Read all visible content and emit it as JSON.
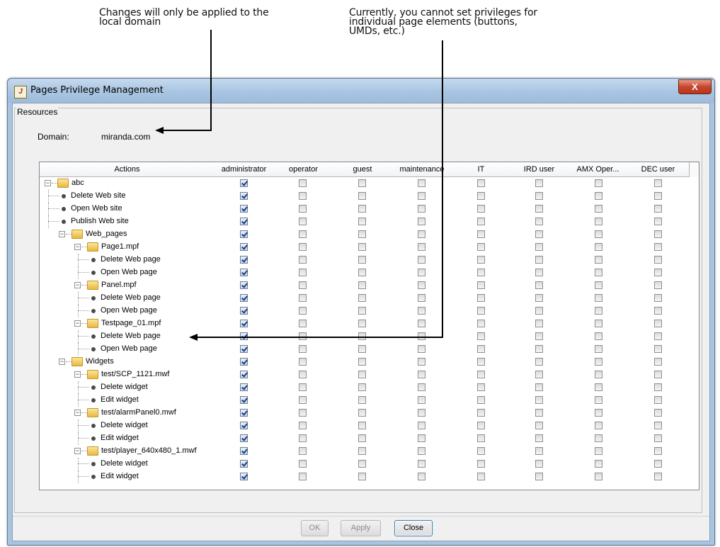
{
  "callouts": {
    "left": [
      "Changes will only be applied to the",
      "local domain"
    ],
    "right": [
      "Currently, you cannot set privileges for",
      "individual page elements (buttons,",
      "UMDs, etc.)"
    ]
  },
  "window": {
    "title": "Pages Privilege Management",
    "close_glyph": "X",
    "app_icon": "jv-app-icon"
  },
  "resources": {
    "group_label": "Resources",
    "domain_label": "Domain:",
    "domain_value": "miranda.com"
  },
  "columns": [
    "Actions",
    "administrator",
    "operator",
    "guest",
    "maintenance",
    "IT",
    "IRD user",
    "AMX Oper...",
    "DEC user"
  ],
  "rows": [
    {
      "label": "abc",
      "type": "folder",
      "level": 0,
      "admin": true
    },
    {
      "label": "Delete Web site",
      "type": "action",
      "level": 1,
      "admin": true
    },
    {
      "label": "Open Web site",
      "type": "action",
      "level": 1,
      "admin": true
    },
    {
      "label": "Publish Web site",
      "type": "action",
      "level": 1,
      "admin": true
    },
    {
      "label": "Web_pages",
      "type": "folder",
      "level": 1,
      "admin": true
    },
    {
      "label": "Page1.mpf",
      "type": "folder",
      "level": 2,
      "admin": true
    },
    {
      "label": "Delete Web page",
      "type": "action",
      "level": 3,
      "admin": true
    },
    {
      "label": "Open Web page",
      "type": "action",
      "level": 3,
      "admin": true
    },
    {
      "label": "Panel.mpf",
      "type": "folder",
      "level": 2,
      "admin": true
    },
    {
      "label": "Delete Web page",
      "type": "action",
      "level": 3,
      "admin": true
    },
    {
      "label": "Open Web page",
      "type": "action",
      "level": 3,
      "admin": true
    },
    {
      "label": "Testpage_01.mpf",
      "type": "folder",
      "level": 2,
      "admin": true
    },
    {
      "label": "Delete Web page",
      "type": "action",
      "level": 3,
      "admin": true
    },
    {
      "label": "Open Web page",
      "type": "action",
      "level": 3,
      "admin": true
    },
    {
      "label": "Widgets",
      "type": "folder",
      "level": 1,
      "admin": true
    },
    {
      "label": "test/SCP_1121.mwf",
      "type": "folder",
      "level": 2,
      "admin": true
    },
    {
      "label": "Delete widget",
      "type": "action",
      "level": 3,
      "admin": true
    },
    {
      "label": "Edit widget",
      "type": "action",
      "level": 3,
      "admin": true
    },
    {
      "label": "test/alarmPanel0.mwf",
      "type": "folder",
      "level": 2,
      "admin": true
    },
    {
      "label": "Delete widget",
      "type": "action",
      "level": 3,
      "admin": true
    },
    {
      "label": "Edit widget",
      "type": "action",
      "level": 3,
      "admin": true
    },
    {
      "label": "test/player_640x480_1.mwf",
      "type": "folder",
      "level": 2,
      "admin": true
    },
    {
      "label": "Delete widget",
      "type": "action",
      "level": 3,
      "admin": true
    },
    {
      "label": "Edit widget",
      "type": "action",
      "level": 3,
      "admin": true
    }
  ],
  "buttons": {
    "ok": {
      "label": "OK",
      "enabled": false
    },
    "apply": {
      "label": "Apply",
      "enabled": false
    },
    "close": {
      "label": "Close",
      "enabled": true
    }
  }
}
